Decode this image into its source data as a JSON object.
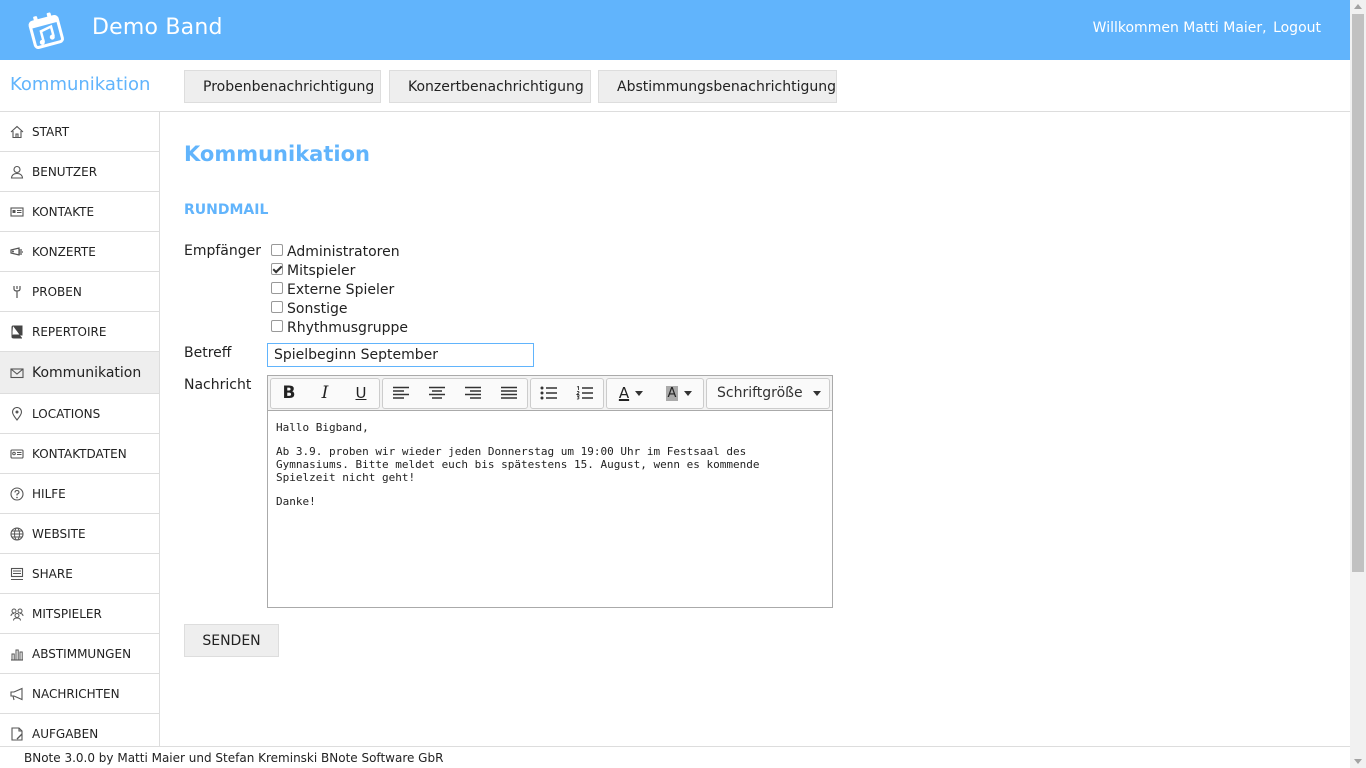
{
  "header": {
    "app_title": "Demo Band",
    "welcome": "Willkommen Matti Maier,",
    "logout": "Logout",
    "brand_color": "#61b4fc"
  },
  "subheader": {
    "section_title": "Kommunikation",
    "actions": [
      {
        "label": "Probenbenachrichtigung",
        "icon": "share-arrow-icon"
      },
      {
        "label": "Konzertbenachrichtigung",
        "icon": "share-arrow-icon"
      },
      {
        "label": "Abstimmungsbenachrichtigung",
        "icon": "share-arrow-icon"
      }
    ]
  },
  "sidebar": {
    "items": [
      {
        "label": "START",
        "icon": "home-icon"
      },
      {
        "label": "BENUTZER",
        "icon": "user-icon"
      },
      {
        "label": "KONTAKTE",
        "icon": "contact-card-icon"
      },
      {
        "label": "KONZERTE",
        "icon": "concert-icon"
      },
      {
        "label": "PROBEN",
        "icon": "rehearsal-icon"
      },
      {
        "label": "REPERTOIRE",
        "icon": "book-icon"
      },
      {
        "label": "Kommunikation",
        "icon": "envelope-icon",
        "active": true
      },
      {
        "label": "LOCATIONS",
        "icon": "map-pin-icon"
      },
      {
        "label": "KONTAKTDATEN",
        "icon": "address-card-icon"
      },
      {
        "label": "HILFE",
        "icon": "help-icon"
      },
      {
        "label": "WEBSITE",
        "icon": "globe-icon"
      },
      {
        "label": "SHARE",
        "icon": "share-icon"
      },
      {
        "label": "MITSPIELER",
        "icon": "group-icon"
      },
      {
        "label": "ABSTIMMUNGEN",
        "icon": "bar-chart-icon"
      },
      {
        "label": "NACHRICHTEN",
        "icon": "megaphone-icon"
      },
      {
        "label": "AUFGABEN",
        "icon": "task-icon"
      }
    ]
  },
  "main": {
    "page_title": "Kommunikation",
    "sub_title": "RUNDMAIL",
    "recipients_label": "Empfänger",
    "recipients": [
      {
        "label": "Administratoren",
        "checked": false
      },
      {
        "label": "Mitspieler",
        "checked": true
      },
      {
        "label": "Externe Spieler",
        "checked": false
      },
      {
        "label": "Sonstige",
        "checked": false
      },
      {
        "label": "Rhythmusgruppe",
        "checked": false
      }
    ],
    "subject_label": "Betreff",
    "subject_value": "Spielbeginn September",
    "message_label": "Nachricht",
    "editor": {
      "bold": "B",
      "italic": "I",
      "underline": "U",
      "font_color": "A",
      "highlight": "A",
      "font_size": "Schriftgröße",
      "paragraphs": [
        "Hallo Bigband,",
        "Ab 3.9. proben wir wieder jeden Donnerstag um 19:00 Uhr im Festsaal des Gymnasiums. Bitte meldet euch bis spätestens 15. August, wenn es kommende Spielzeit nicht geht!",
        "Danke!"
      ]
    },
    "send_button": "SENDEN"
  },
  "footer": {
    "text": "BNote 3.0.0 by Matti Maier und Stefan Kreminski BNote Software GbR"
  }
}
